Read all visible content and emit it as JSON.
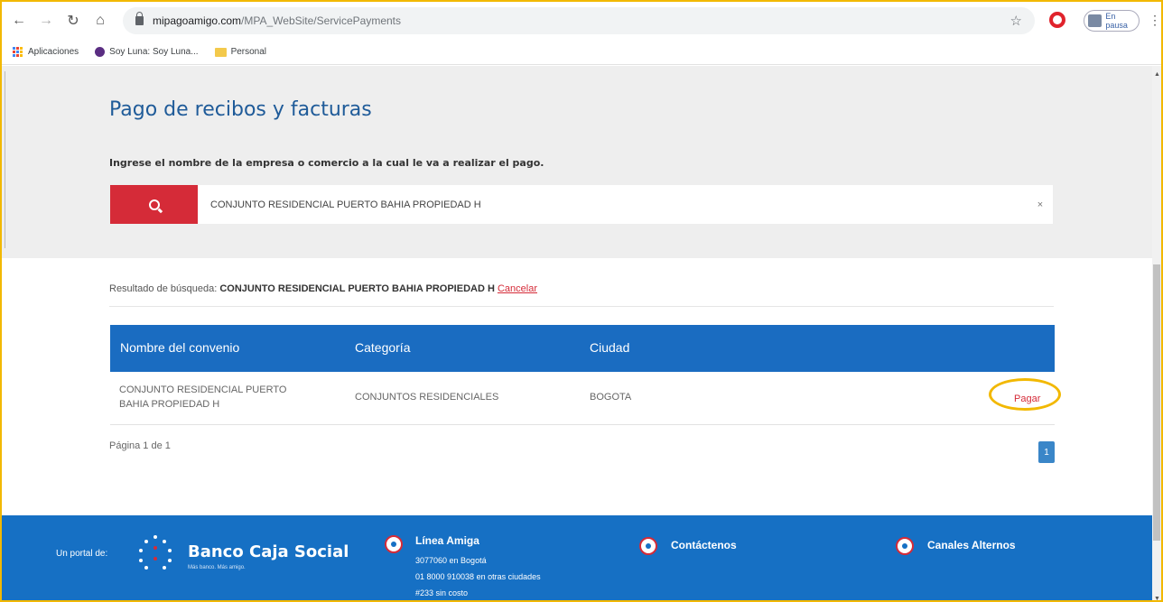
{
  "browser": {
    "url_host": "mipagoamigo.com",
    "url_path": "/MPA_WebSite/ServicePayments",
    "profile_status": "En pausa"
  },
  "bookmarks": [
    "Aplicaciones",
    "Soy Luna: Soy Luna...",
    "Personal"
  ],
  "page": {
    "title": "Pago de recibos y facturas",
    "instruction": "Ingrese el nombre de la empresa o comercio a la cual le va a realizar el pago.",
    "search_value": "CONJUNTO RESIDENCIAL PUERTO BAHIA PROPIEDAD H",
    "result_label": "Resultado de búsqueda:",
    "result_query": "CONJUNTO RESIDENCIAL PUERTO BAHIA PROPIEDAD H",
    "cancel_label": "Cancelar",
    "table": {
      "headers": [
        "Nombre del convenio",
        "Categoría",
        "Ciudad"
      ],
      "rows": [
        {
          "name_line1": "CONJUNTO RESIDENCIAL PUERTO",
          "name_line2": "BAHIA PROPIEDAD H",
          "category": "CONJUNTOS RESIDENCIALES",
          "city": "BOGOTA",
          "action": "Pagar"
        }
      ]
    },
    "pagination_text": "Página 1 de 1",
    "current_page": "1"
  },
  "footer": {
    "portal_label": "Un portal de:",
    "brand": "Banco Caja Social",
    "tagline": "Más banco. Más amigo.",
    "linea_title": "Línea Amiga",
    "linea_lines": [
      "3077060 en Bogotá",
      "01 8000 910038 en otras ciudades",
      "#233 sin costo"
    ],
    "contact_title": "Contáctenos",
    "channels_title": "Canales Alternos"
  },
  "colors": {
    "brand_blue": "#1670c4",
    "header_blue": "#1a6cc1",
    "accent_red": "#d52b38",
    "highlight": "#f2b800"
  }
}
